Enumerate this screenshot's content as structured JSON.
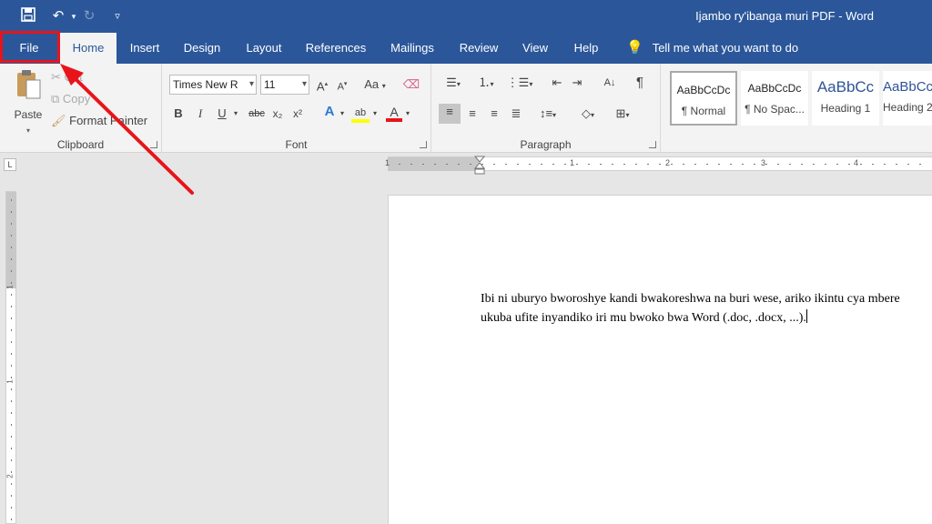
{
  "window": {
    "title": "Ijambo ry'ibanga muri PDF  -  Word"
  },
  "quick_access": {
    "save_icon": "save-icon",
    "undo_icon": "undo-icon",
    "redo_icon": "redo-icon",
    "customize_icon": "customize-qat-icon"
  },
  "tabs": [
    "File",
    "Home",
    "Insert",
    "Design",
    "Layout",
    "References",
    "Mailings",
    "Review",
    "View",
    "Help"
  ],
  "tell_me": "Tell me what you want to do",
  "clipboard": {
    "label": "Clipboard",
    "paste": "Paste",
    "cut": "Cut",
    "copy": "Copy",
    "format_painter": "Format Painter"
  },
  "font": {
    "label": "Font",
    "name": "Times New R",
    "size": "11",
    "change_case": "Aa",
    "bold": "B",
    "italic": "I",
    "underline": "U",
    "strike": "abc",
    "sub": "x₂",
    "sup": "x²"
  },
  "paragraph": {
    "label": "Paragraph"
  },
  "styles": [
    {
      "preview": "AaBbCcDc",
      "name": "¶ Normal"
    },
    {
      "preview": "AaBbCcDc",
      "name": "¶ No Spac..."
    },
    {
      "preview": "AaBbCc",
      "name": "Heading 1"
    },
    {
      "preview": "AaBbCc",
      "name": "Heading 2"
    }
  ],
  "ruler": {
    "h_numbers": [
      "1",
      "1",
      "2",
      "3",
      "4"
    ],
    "v_numbers": [
      "1",
      "1",
      "2"
    ]
  },
  "document": {
    "lines": [
      "Ibi ni uburyo bworoshye kandi bwakoreshwa na buri wese, ariko ikintu cya mbere",
      "ukuba ufite inyandiko iri mu bwoko bwa Word (.doc, .docx, ...)."
    ]
  },
  "annotation": {
    "highlight_color": "#e8141a",
    "points_to": "File"
  },
  "colors": {
    "accent": "#2b579a",
    "ribbon": "#f3f3f3",
    "canvas": "#e6e6e6"
  }
}
